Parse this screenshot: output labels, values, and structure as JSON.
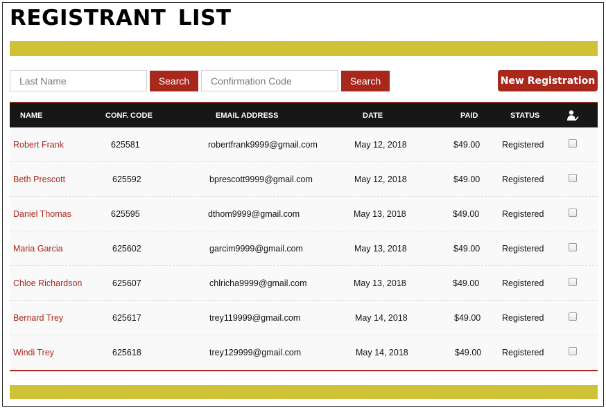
{
  "page": {
    "title": "REGISTRANT  LIST"
  },
  "search": {
    "last_name_placeholder": "Last Name",
    "last_name_value": "",
    "search_label_1": "Search",
    "conf_code_placeholder": "Confirmation Code",
    "conf_code_value": "",
    "search_label_2": "Search",
    "new_registration_label": "New Registration"
  },
  "colors": {
    "accent_red": "#a8281c",
    "band_yellow": "#cdbf2e",
    "header_dark": "#171717"
  },
  "table": {
    "headers": {
      "name": "NAME",
      "conf_code": "CONF. CODE",
      "email": "EMAIL ADDRESS",
      "date": "DATE",
      "paid": "PAID",
      "status": "STATUS",
      "checkin_icon": "user-check-icon"
    },
    "rows": [
      {
        "name": "Robert Frank",
        "conf_code": "625581",
        "email": "robertfrank9999@gmail.com",
        "date": "May 12, 2018",
        "paid": "$49.00",
        "status": "Registered",
        "checked": false
      },
      {
        "name": "Beth Prescott",
        "conf_code": "625592",
        "email": "bprescott9999@gmail.com",
        "date": "May 12, 2018",
        "paid": "$49.00",
        "status": "Registered",
        "checked": false
      },
      {
        "name": "Daniel Thomas",
        "conf_code": "625595",
        "email": "dthom9999@gmail.com",
        "date": "May 13, 2018",
        "paid": "$49.00",
        "status": "Registered",
        "checked": false
      },
      {
        "name": "Maria Garcia",
        "conf_code": "625602",
        "email": "garcim9999@gmail.com",
        "date": "May 13, 2018",
        "paid": "$49.00",
        "status": "Registered",
        "checked": false
      },
      {
        "name": "Chloe Richardson",
        "conf_code": "625607",
        "email": "chlricha9999@gmail.com",
        "date": "May 13, 2018",
        "paid": "$49.00",
        "status": "Registered",
        "checked": false
      },
      {
        "name": "Bernard Trey",
        "conf_code": "625617",
        "email": "trey119999@gmail.com",
        "date": "May 14, 2018",
        "paid": "$49.00",
        "status": "Registered",
        "checked": false
      },
      {
        "name": "Windi Trey",
        "conf_code": "625618",
        "email": "trey129999@gmail.com",
        "date": "May 14, 2018",
        "paid": "$49.00",
        "status": "Registered",
        "checked": false
      }
    ]
  }
}
